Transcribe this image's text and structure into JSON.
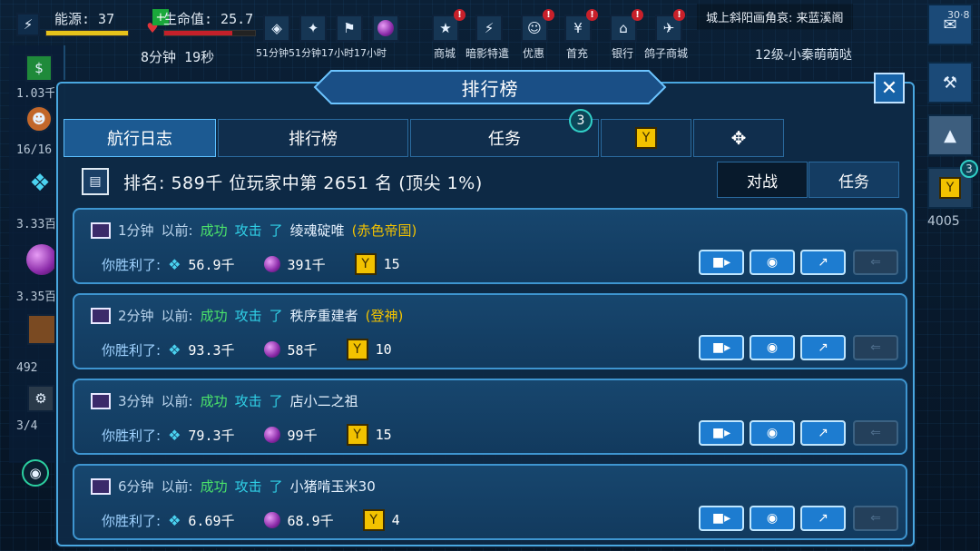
{
  "topbar": {
    "energy_label": "能源: 37",
    "health_label": "生命值: 25.7",
    "timer": "8分钟 19秒",
    "timers": [
      "51分钟51分钟17小时17小时"
    ],
    "nav": [
      {
        "label": "商城",
        "icon": "star-icon"
      },
      {
        "label": "暗影特遣",
        "icon": "shadow-icon"
      },
      {
        "label": "优惠",
        "icon": "deal-icon"
      },
      {
        "label": "首充",
        "icon": "first-charge-icon"
      },
      {
        "label": "银行",
        "icon": "bank-icon"
      },
      {
        "label": "鸽子商城",
        "icon": "pigeon-shop-icon"
      }
    ],
    "chat": "城上斜阳画角哀: 来蓝溪阁",
    "level_label": "12级-小秦萌萌哒",
    "chat_count": "30·8"
  },
  "left": {
    "values": [
      "1.03千",
      "16/16",
      "3.33百",
      "3.35百",
      "492",
      "3/4"
    ]
  },
  "right": {
    "score": "4005",
    "badge": "3"
  },
  "modal": {
    "title": "排行榜",
    "tabs": [
      "航行日志",
      "排行榜",
      "任务"
    ],
    "tab_badge": "3",
    "rank_text": "排名: 589千 位玩家中第 2651 名 (顶尖 1%)",
    "subtabs": [
      "对战",
      "任务"
    ],
    "entries": [
      {
        "time": "1分钟",
        "ago": "以前:",
        "result": "成功",
        "action": "攻击",
        "verb": "了",
        "target": "绫魂碇唯",
        "faction": "(赤色帝国)",
        "won": "你胜利了:",
        "crystal": "56.9千",
        "orb": "391千",
        "trophy": "15"
      },
      {
        "time": "2分钟",
        "ago": "以前:",
        "result": "成功",
        "action": "攻击",
        "verb": "了",
        "target": "秩序重建者",
        "faction": "(登神)",
        "won": "你胜利了:",
        "crystal": "93.3千",
        "orb": "58千",
        "trophy": "10"
      },
      {
        "time": "3分钟",
        "ago": "以前:",
        "result": "成功",
        "action": "攻击",
        "verb": "了",
        "target": "店小二之祖",
        "faction": "",
        "won": "你胜利了:",
        "crystal": "79.3千",
        "orb": "99千",
        "trophy": "15"
      },
      {
        "time": "6分钟",
        "ago": "以前:",
        "result": "成功",
        "action": "攻击",
        "verb": "了",
        "target": "小猪啃玉米30",
        "faction": "",
        "won": "你胜利了:",
        "crystal": "6.69千",
        "orb": "68.9千",
        "trophy": "4"
      }
    ]
  },
  "colors": {
    "accent": "#49a7e0",
    "success": "#4be36a",
    "attack": "#30d0e6",
    "faction": "#f2c200"
  }
}
